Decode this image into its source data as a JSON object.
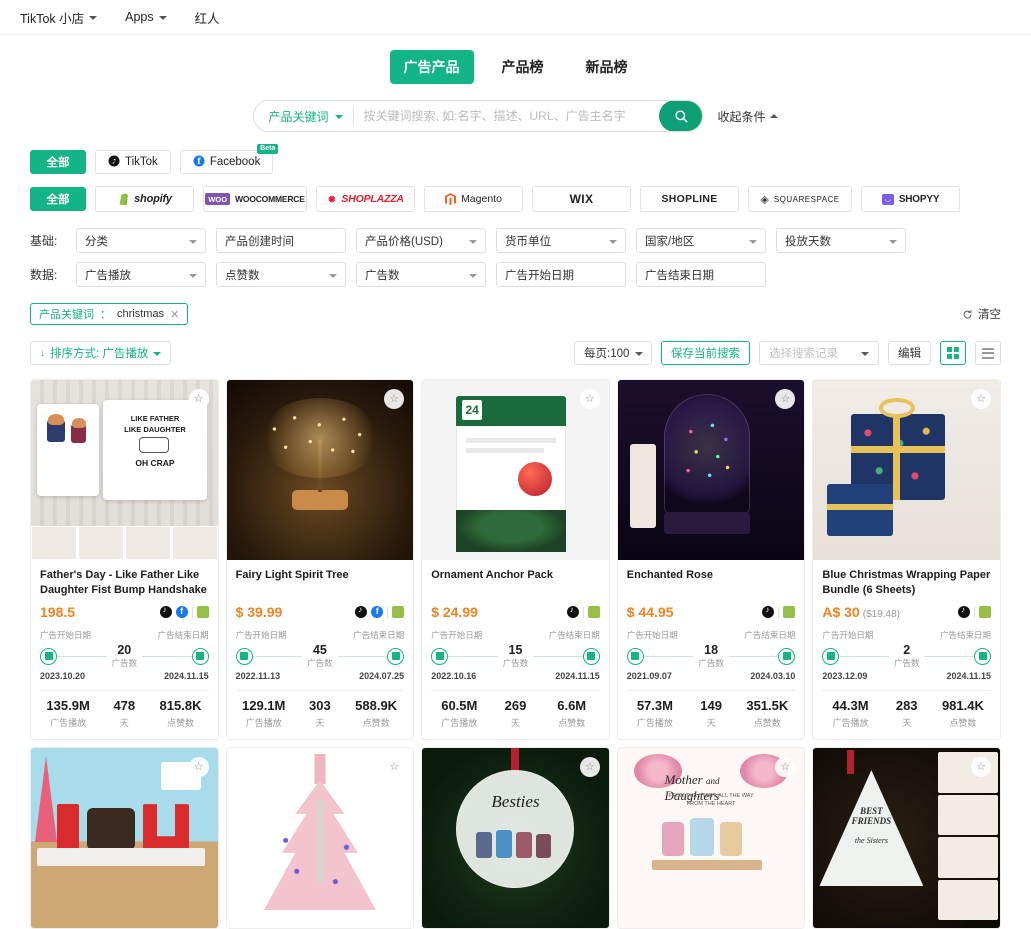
{
  "topnav": {
    "items": [
      {
        "label": "TikTok 小店",
        "caret": true,
        "name": "nav-tiktok-shop"
      },
      {
        "label": "Apps",
        "caret": true,
        "name": "nav-apps"
      },
      {
        "label": "红人",
        "caret": false,
        "name": "nav-influencer"
      }
    ]
  },
  "main_tabs": [
    {
      "label": "广告产品",
      "active": true
    },
    {
      "label": "产品榜",
      "active": false
    },
    {
      "label": "新品榜",
      "active": false
    }
  ],
  "search": {
    "scope_label": "产品关键词",
    "placeholder": "按关键词搜索, 如:名字、描述、URL、广告主名字",
    "value": "",
    "search_icon": "search-icon",
    "collapse_label": "收起条件"
  },
  "channel_filters": {
    "items": [
      {
        "label": "全部",
        "active": true,
        "icon": null
      },
      {
        "label": "TikTok",
        "active": false,
        "icon": "tiktok-icon"
      },
      {
        "label": "Facebook",
        "active": false,
        "icon": "facebook-icon",
        "badge": "Beta"
      }
    ]
  },
  "platform_filters": {
    "items": [
      {
        "label": "全部",
        "active": true,
        "logo": null
      },
      {
        "label": "shopify",
        "logo": "shopify-logo"
      },
      {
        "label": "WOOCOMMERCE",
        "logo": "woocommerce-logo"
      },
      {
        "label": "SHOPLAZZA",
        "logo": "shoplazza-logo"
      },
      {
        "label": "Magento",
        "logo": "magento-logo"
      },
      {
        "label": "WIX",
        "logo": "wix-logo"
      },
      {
        "label": "SHOPLINE",
        "logo": "shopline-logo"
      },
      {
        "label": "SQUARESPACE",
        "logo": "squarespace-logo"
      },
      {
        "label": "SHOPYY",
        "logo": "shopyy-logo"
      }
    ]
  },
  "filter_rows": [
    {
      "label": "基础:",
      "fields": [
        {
          "value": "分类",
          "caret": true,
          "name": "filter-category"
        },
        {
          "value": "产品创建时间",
          "caret": false,
          "name": "filter-product-create-time"
        },
        {
          "value": "产品价格(USD)",
          "caret": true,
          "name": "filter-product-price"
        },
        {
          "value": "货币单位",
          "caret": true,
          "name": "filter-currency"
        },
        {
          "value": "国家/地区",
          "caret": true,
          "name": "filter-country-region"
        },
        {
          "value": "投放天数",
          "caret": true,
          "name": "filter-running-days"
        }
      ]
    },
    {
      "label": "数据:",
      "fields": [
        {
          "value": "广告播放",
          "caret": true,
          "name": "filter-ad-views"
        },
        {
          "value": "点赞数",
          "caret": true,
          "name": "filter-likes"
        },
        {
          "value": "广告数",
          "caret": true,
          "name": "filter-ad-count"
        },
        {
          "value": "广告开始日期",
          "caret": false,
          "name": "filter-ad-start-date"
        },
        {
          "value": "广告结束日期",
          "caret": false,
          "name": "filter-ad-end-date"
        }
      ]
    }
  ],
  "active_tag": {
    "key": "产品关键词",
    "sep": "：",
    "value": "christmas",
    "close": "✕"
  },
  "clear_button": {
    "label": "清空",
    "icon": "refresh-icon"
  },
  "toolbar": {
    "sort_label": "排序方式: 广告播放",
    "page_size_label": "每页:100",
    "save_search_label": "保存当前搜索",
    "search_record_label": "选择搜索记录",
    "edit_label": "编辑",
    "grid_view_icon": "grid-view-icon",
    "list_view_icon": "list-view-icon"
  },
  "card_labels": {
    "start_date": "广告开始日期",
    "end_date": "广告结束日期",
    "ad_count": "广告数",
    "stat_views": "广告播放",
    "stat_days": "天",
    "stat_likes": "点赞数"
  },
  "products": [
    {
      "title": "Father's Day - Like Father Like Daughter Fist Bump Handshake -...",
      "price": "198.5",
      "price_sub": "",
      "platforms": [
        "tiktok",
        "facebook",
        "shopify"
      ],
      "start_date": "2023.10.20",
      "end_date": "2024.11.15",
      "ad_count": "20",
      "views": "135.9M",
      "days": "478",
      "likes": "815.8K",
      "image": "mug-father-daughter"
    },
    {
      "title": "Fairy Light Spirit Tree",
      "price": "$ 39.99",
      "price_sub": "",
      "platforms": [
        "tiktok",
        "facebook",
        "shopify"
      ],
      "start_date": "2022.11.13",
      "end_date": "2024.07.25",
      "ad_count": "45",
      "views": "129.1M",
      "days": "303",
      "likes": "588.9K",
      "image": "fairy-light-tree"
    },
    {
      "title": "Ornament Anchor Pack",
      "price": "$ 24.99",
      "price_sub": "",
      "platforms": [
        "tiktok",
        "shopify"
      ],
      "start_date": "2022.10.16",
      "end_date": "2024.11.15",
      "ad_count": "15",
      "views": "60.5M",
      "days": "269",
      "likes": "6.6M",
      "image": "ornament-anchor-pack"
    },
    {
      "title": "Enchanted Rose",
      "price": "$ 44.95",
      "price_sub": "",
      "platforms": [
        "tiktok",
        "shopify"
      ],
      "start_date": "2021.09.07",
      "end_date": "2024.03.10",
      "ad_count": "18",
      "views": "57.3M",
      "days": "149",
      "likes": "351.5K",
      "image": "enchanted-rose"
    },
    {
      "title": "Blue Christmas Wrapping Paper Bundle (6 Sheets)",
      "price": "A$ 30",
      "price_sub": "($19.48)",
      "platforms": [
        "tiktok",
        "shopify"
      ],
      "start_date": "2023.12.09",
      "end_date": "2024.11.15",
      "ad_count": "2",
      "views": "44.3M",
      "days": "283",
      "likes": "981.4K",
      "image": "blue-wrapping-paper"
    }
  ],
  "products_row2": [
    {
      "image": "lego-i-love-u"
    },
    {
      "image": "pink-tree-card"
    },
    {
      "image": "besties-forever-ornament"
    },
    {
      "image": "mother-daughters-print"
    },
    {
      "image": "best-friends-sisters-ornament"
    }
  ],
  "colors": {
    "accent": "#13b485",
    "price": "#f5811f",
    "text": "#1c1c1c",
    "muted": "#9a9a9a"
  }
}
